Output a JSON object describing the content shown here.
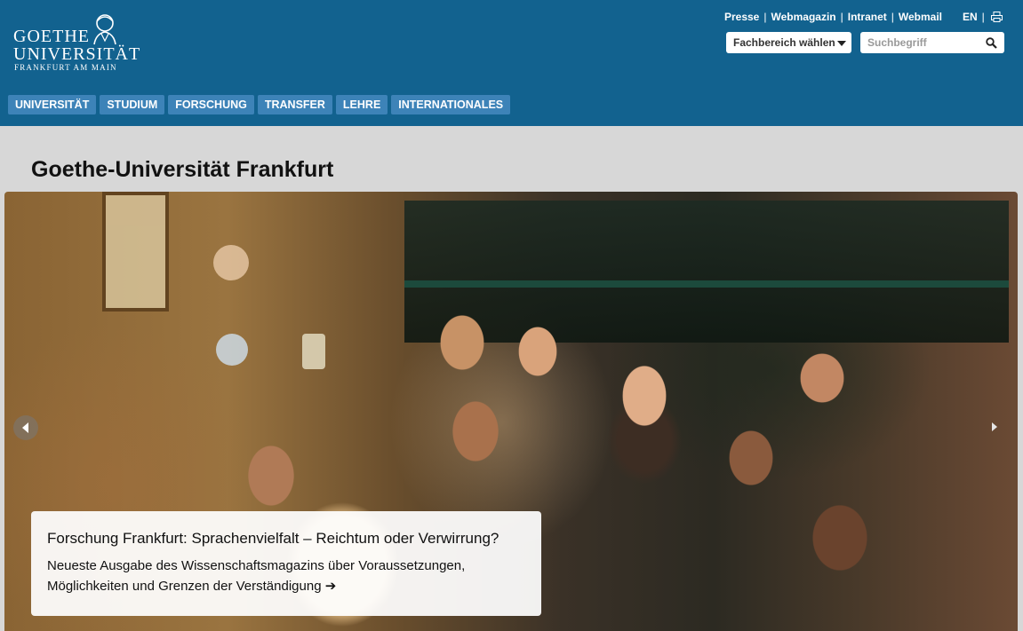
{
  "logo": {
    "line1": "GOETHE",
    "line2": "UNIVERSITÄT",
    "line3": "FRANKFURT AM MAIN"
  },
  "toplinks": [
    "Presse",
    "Webmagazin",
    "Intranet",
    "Webmail"
  ],
  "lang": "EN",
  "fachbereich_select": {
    "selected": "Fachbereich wählen"
  },
  "search": {
    "placeholder": "Suchbegriff"
  },
  "nav": [
    "UNIVERSITÄT",
    "STUDIUM",
    "FORSCHUNG",
    "TRANSFER",
    "LEHRE",
    "INTERNATIONALES"
  ],
  "page_title": "Goethe-Universität Frankfurt",
  "hero": {
    "title": "Forschung Frankfurt: Sprachenvielfalt – Reichtum oder Verwirrung?",
    "text": "Neueste Ausgabe des Wissenschaftsmagazins über Voraussetzungen, Möglichkeiten und Grenzen der Verständigung ➔"
  },
  "icons": {
    "print": "print-icon",
    "search": "search-icon",
    "prev": "chevron-left-icon",
    "next": "chevron-right-icon"
  },
  "colors": {
    "header_bg": "#12628f",
    "nav_item_bg": "#3d83b8",
    "page_bg": "#d7d7d7"
  }
}
